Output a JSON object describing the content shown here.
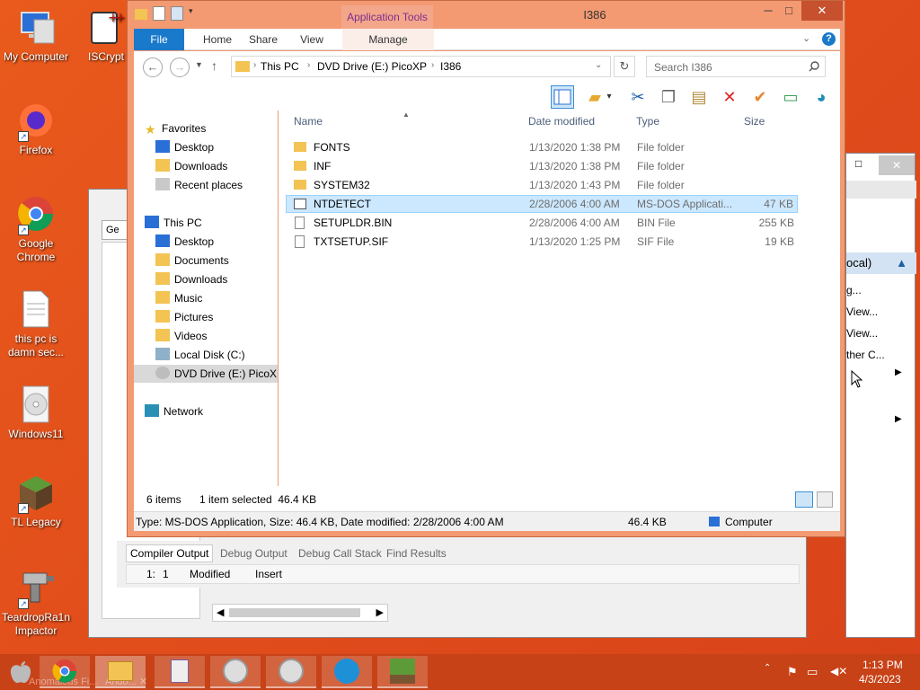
{
  "desktop": {
    "icons": [
      {
        "label": "My Computer"
      },
      {
        "label": "ISCrypt"
      },
      {
        "label": "Firefox"
      },
      {
        "label": "Google Chrome"
      },
      {
        "label": "this pc is damn sec..."
      },
      {
        "label": "Windows11"
      },
      {
        "label": "TL Legacy"
      },
      {
        "label": "TeardropRa1n Impactor"
      }
    ]
  },
  "background_window": {
    "tab_text": "Ge",
    "bottom_tabs": [
      "Compiler Output",
      "Debug Output",
      "Debug Call Stack",
      "Find Results"
    ],
    "status": {
      "line": "1:",
      "col": "1",
      "modified": "Modified",
      "mode": "Insert"
    },
    "right_panel": {
      "heading": "ocal)",
      "items": [
        "g...",
        "View...",
        "View...",
        "ther C..."
      ]
    }
  },
  "explorer": {
    "title": "I386",
    "context_tab": "Application Tools",
    "tabs": [
      "File",
      "Home",
      "Share",
      "View",
      "Manage"
    ],
    "address": [
      "This PC",
      "DVD Drive (E:) PicoXP",
      "I386"
    ],
    "search_placeholder": "Search I386",
    "columns": {
      "name": "Name",
      "date": "Date modified",
      "type": "Type",
      "size": "Size"
    },
    "nav": {
      "favorites": "Favorites",
      "desktop": "Desktop",
      "downloads": "Downloads",
      "recent": "Recent places",
      "thispc": "This PC",
      "desktop2": "Desktop",
      "documents": "Documents",
      "downloads2": "Downloads",
      "music": "Music",
      "pictures": "Pictures",
      "videos": "Videos",
      "localdisk": "Local Disk (C:)",
      "dvd": "DVD Drive (E:) PicoX",
      "network": "Network"
    },
    "files": [
      {
        "name": "FONTS",
        "date": "1/13/2020 1:38 PM",
        "type": "File folder",
        "size": ""
      },
      {
        "name": "INF",
        "date": "1/13/2020 1:38 PM",
        "type": "File folder",
        "size": ""
      },
      {
        "name": "SYSTEM32",
        "date": "1/13/2020 1:43 PM",
        "type": "File folder",
        "size": ""
      },
      {
        "name": "NTDETECT",
        "date": "2/28/2006 4:00 AM",
        "type": "MS-DOS Applicati...",
        "size": "47 KB"
      },
      {
        "name": "SETUPLDR.BIN",
        "date": "2/28/2006 4:00 AM",
        "type": "BIN File",
        "size": "255 KB"
      },
      {
        "name": "TXTSETUP.SIF",
        "date": "1/13/2020 1:25 PM",
        "type": "SIF File",
        "size": "19 KB"
      }
    ],
    "status": {
      "count": "6 items",
      "selection": "1 item selected  46.4 KB"
    },
    "details_bar": {
      "text": "Type: MS-DOS Application, Size: 46.4 KB, Date modified: 2/28/2006 4:00 AM",
      "size": "46.4 KB",
      "location": "Computer"
    }
  },
  "taskbar": {
    "ghost_text": "Anomalous Fi...   Ando... ✕",
    "time": "1:13 PM",
    "date": "4/3/2023"
  },
  "colors": {
    "accent": "#1979ca",
    "desktop": "#e8501e",
    "titlebar": "#f39a72",
    "selection": "#cce8ff"
  }
}
